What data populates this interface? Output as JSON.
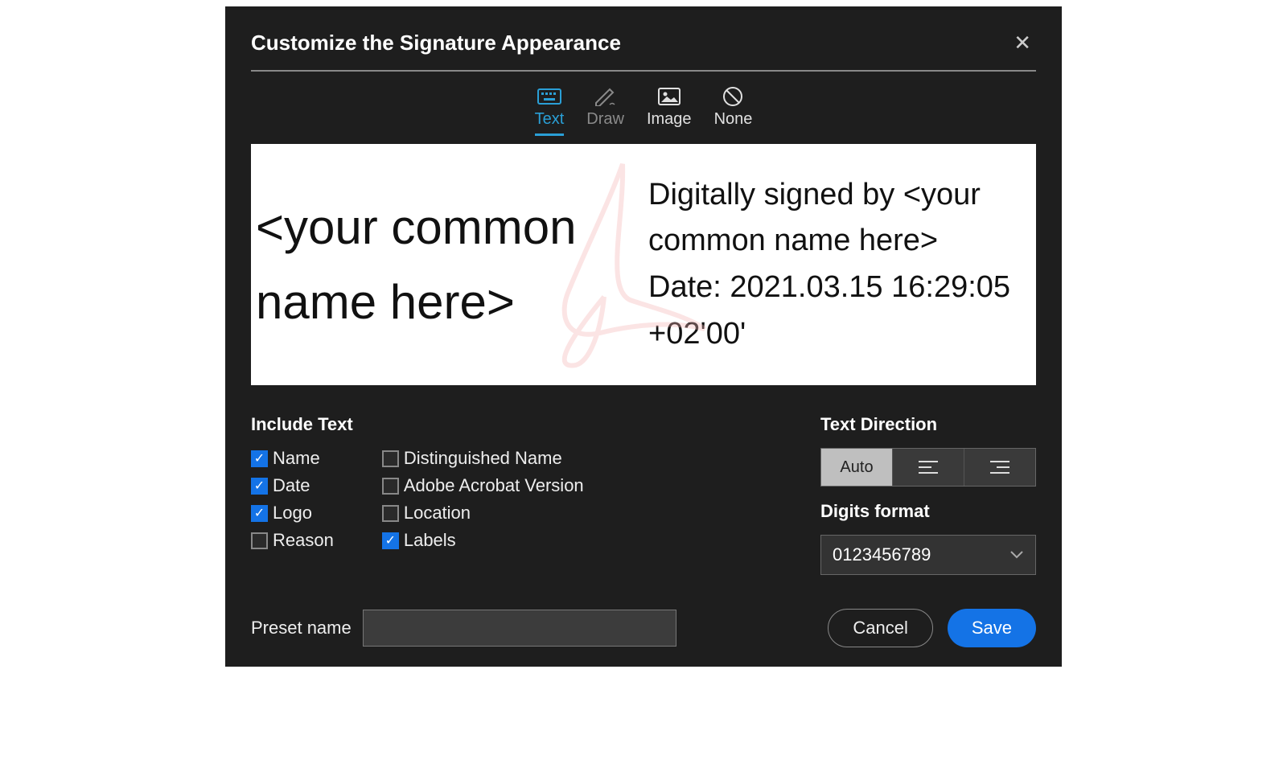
{
  "dialog": {
    "title": "Customize the Signature Appearance",
    "close": "✕"
  },
  "tabs": {
    "text": "Text",
    "draw": "Draw",
    "image": "Image",
    "none": "None"
  },
  "preview": {
    "left": "<your common name here>",
    "right": "Digitally signed by <your common name here>\nDate: 2021.03.15 16:29:05 +02'00'"
  },
  "include": {
    "title": "Include Text",
    "items": [
      {
        "id": "name",
        "label": "Name",
        "checked": true
      },
      {
        "id": "date",
        "label": "Date",
        "checked": true
      },
      {
        "id": "logo",
        "label": "Logo",
        "checked": true
      },
      {
        "id": "reason",
        "label": "Reason",
        "checked": false
      },
      {
        "id": "dn",
        "label": "Distinguished Name",
        "checked": false
      },
      {
        "id": "version",
        "label": "Adobe Acrobat Version",
        "checked": false
      },
      {
        "id": "location",
        "label": "Location",
        "checked": false
      },
      {
        "id": "labels",
        "label": "Labels",
        "checked": true
      }
    ]
  },
  "direction": {
    "title": "Text Direction",
    "auto": "Auto"
  },
  "digits": {
    "title": "Digits format",
    "value": "0123456789"
  },
  "preset": {
    "label": "Preset name",
    "value": ""
  },
  "buttons": {
    "cancel": "Cancel",
    "save": "Save"
  }
}
